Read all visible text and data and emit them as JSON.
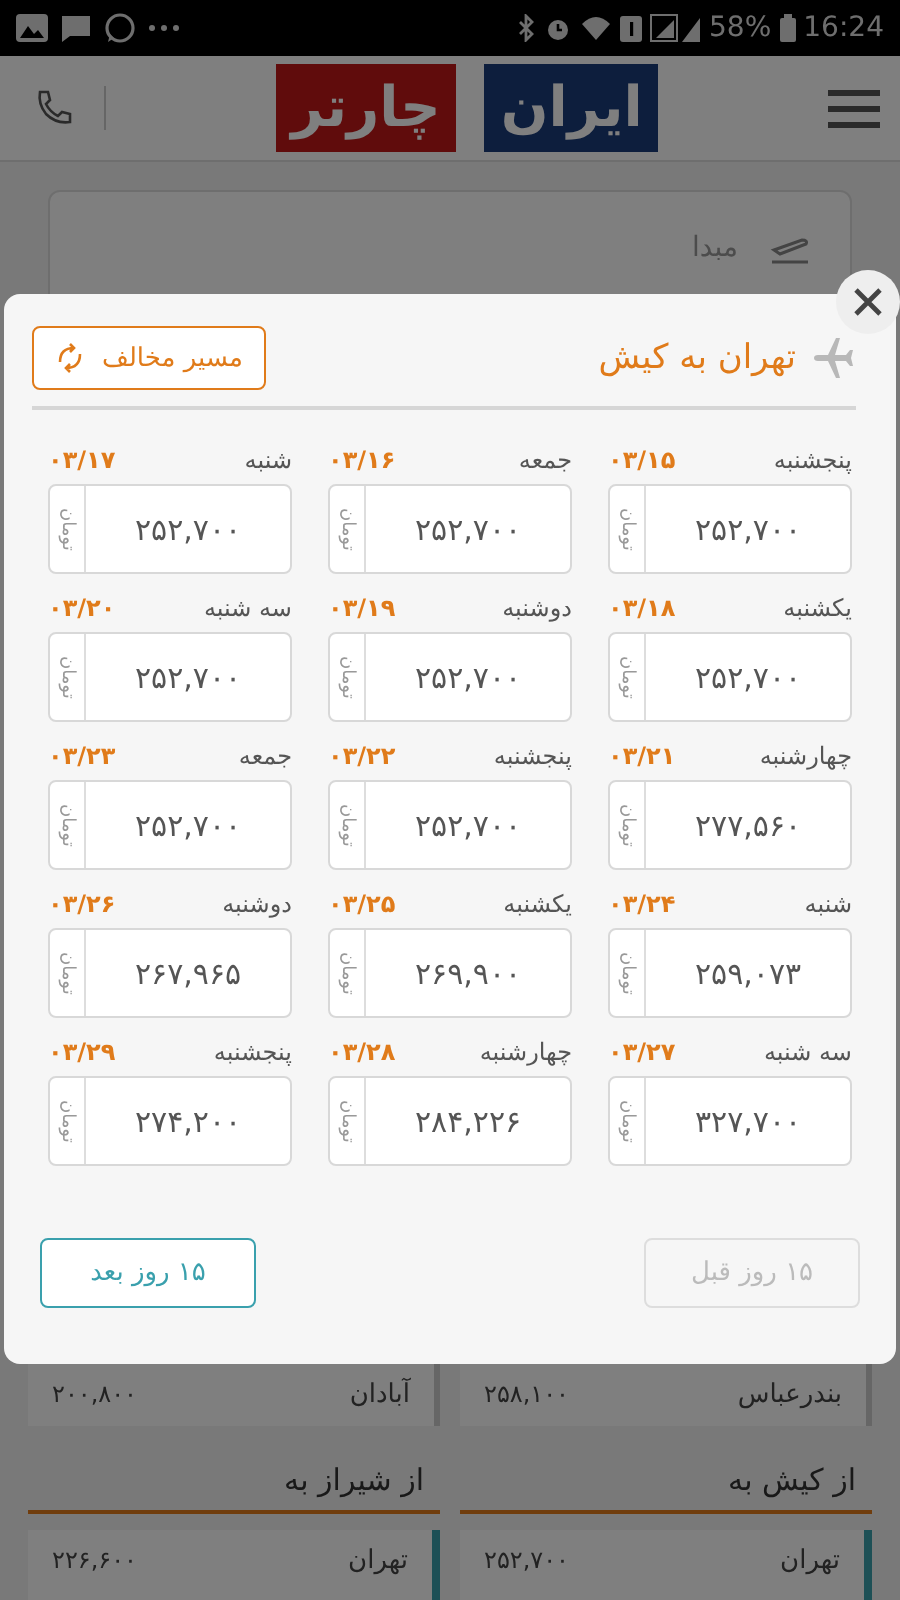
{
  "status_bar": {
    "battery": "58%",
    "time": "16:24"
  },
  "header": {
    "logo_left": "چارتر",
    "logo_right": "ایران"
  },
  "search": {
    "origin_placeholder": "مبدا"
  },
  "modal": {
    "route": "تهران به کیش",
    "reverse_button": "مسیر مخالف",
    "days": [
      {
        "day": "پنجشنبه",
        "date": "۰۳/۱۵",
        "price": "۲۵۲,۷۰۰",
        "currency": "تومان"
      },
      {
        "day": "جمعه",
        "date": "۰۳/۱۶",
        "price": "۲۵۲,۷۰۰",
        "currency": "تومان"
      },
      {
        "day": "شنبه",
        "date": "۰۳/۱۷",
        "price": "۲۵۲,۷۰۰",
        "currency": "تومان"
      },
      {
        "day": "یکشنبه",
        "date": "۰۳/۱۸",
        "price": "۲۵۲,۷۰۰",
        "currency": "تومان"
      },
      {
        "day": "دوشنبه",
        "date": "۰۳/۱۹",
        "price": "۲۵۲,۷۰۰",
        "currency": "تومان"
      },
      {
        "day": "سه شنبه",
        "date": "۰۳/۲۰",
        "price": "۲۵۲,۷۰۰",
        "currency": "تومان"
      },
      {
        "day": "چهارشنبه",
        "date": "۰۳/۲۱",
        "price": "۲۷۷,۵۶۰",
        "currency": "تومان"
      },
      {
        "day": "پنجشنبه",
        "date": "۰۳/۲۲",
        "price": "۲۵۲,۷۰۰",
        "currency": "تومان"
      },
      {
        "day": "جمعه",
        "date": "۰۳/۲۳",
        "price": "۲۵۲,۷۰۰",
        "currency": "تومان"
      },
      {
        "day": "شنبه",
        "date": "۰۳/۲۴",
        "price": "۲۵۹,۰۷۳",
        "currency": "تومان"
      },
      {
        "day": "یکشنبه",
        "date": "۰۳/۲۵",
        "price": "۲۶۹,۹۰۰",
        "currency": "تومان"
      },
      {
        "day": "دوشنبه",
        "date": "۰۳/۲۶",
        "price": "۲۶۷,۹۶۵",
        "currency": "تومان"
      },
      {
        "day": "سه شنبه",
        "date": "۰۳/۲۷",
        "price": "۳۲۷,۷۰۰",
        "currency": "تومان"
      },
      {
        "day": "چهارشنبه",
        "date": "۰۳/۲۸",
        "price": "۲۸۴,۲۲۶",
        "currency": "تومان"
      },
      {
        "day": "پنجشنبه",
        "date": "۰۳/۲۹",
        "price": "۲۷۴,۲۰۰",
        "currency": "تومان"
      }
    ],
    "prev_button": {
      "label": "۱۵ روز قبل",
      "disabled": true
    },
    "next_button": {
      "label": "۱۵ روز بعد",
      "disabled": false
    }
  },
  "routes": [
    {
      "rows": [
        {
          "city": "بندرعباس",
          "price": "۲۵۸,۱۰۰"
        }
      ]
    },
    {
      "rows": [
        {
          "city": "آبادان",
          "price": "۲۰۰,۸۰۰"
        }
      ]
    }
  ],
  "route_groups": [
    {
      "title": "از کیش به",
      "rows": [
        {
          "city": "تهران",
          "price": "۲۵۲,۷۰۰"
        }
      ]
    },
    {
      "title": "از شیراز به",
      "rows": [
        {
          "city": "تهران",
          "price": "۲۲۶,۶۰۰"
        }
      ]
    }
  ]
}
